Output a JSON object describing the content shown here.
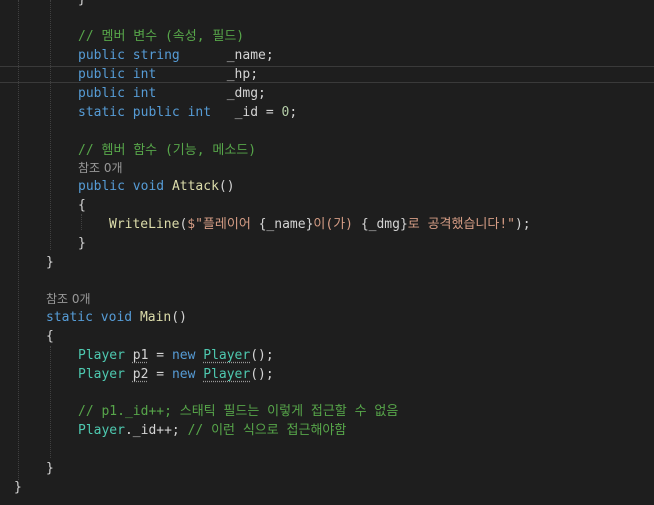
{
  "colors": {
    "background": "#1e1e1e",
    "keyword": "#569cd6",
    "type": "#4ec9b0",
    "comment": "#57a64a",
    "method": "#dcdcaa",
    "string": "#d69d85",
    "number": "#b5cea8",
    "text": "#d4d4d4",
    "codelens": "#999999"
  },
  "code": {
    "brace_close_top": "}",
    "comment_members": "// 멤버 변수 (속성, 필드)",
    "kw_public": "public",
    "kw_static": "static",
    "kw_string": "string",
    "kw_int": "int",
    "kw_void": "void",
    "kw_new": "new",
    "field_name": "_name;",
    "field_hp": "_hp;",
    "field_dmg": "_dmg;",
    "field_id": "_id",
    "op_assign": "=",
    "zero": "0",
    "semicolon": ";",
    "comment_methods": "// 헴버 함수 (기능, 메소드)",
    "codelens_refs": "참조 0개",
    "method_attack": "Attack",
    "parens_empty": "()",
    "brace_open": "{",
    "brace_close": "}",
    "writeline": "WriteLine",
    "paren_open": "(",
    "string_prefix": "$\"플레이어 ",
    "interp_name": "{_name}",
    "string_mid": "이(가) ",
    "interp_dmg": "{_dmg}",
    "string_suffix": "로 공격했습니다!\"",
    "paren_close_semi": ");",
    "method_main": "Main",
    "class_player": "Player",
    "var_p1": "p1",
    "var_p2": "p2",
    "parens_semi": "();",
    "comment_p1": "// p1._id++; 스태틱 필드는 이렇게 접근할 수 없음",
    "player_access": "._id++;",
    "comment_access": "// 이런 식으로 접근해야함"
  }
}
